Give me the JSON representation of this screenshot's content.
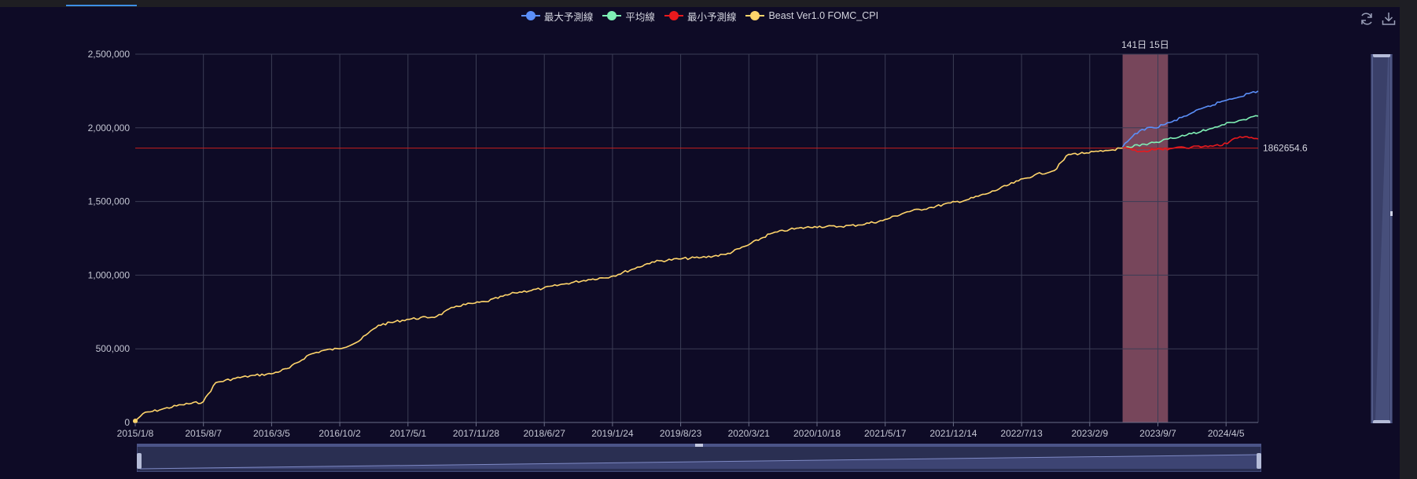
{
  "legend": [
    {
      "label": "最大予測線",
      "color": "#5b8ff9"
    },
    {
      "label": "平均線",
      "color": "#7ff0b5"
    },
    {
      "label": "最小予測線",
      "color": "#e8191d"
    },
    {
      "label": "Beast Ver1.0 FOMC_CPI",
      "color": "#ffd56b"
    }
  ],
  "toolbox": {
    "refresh_icon": "refresh-icon",
    "download_icon": "download-icon"
  },
  "chart_data": {
    "type": "line",
    "x_tick_labels": [
      "2015/1/8",
      "2015/8/7",
      "2016/3/5",
      "2016/10/2",
      "2017/5/1",
      "2017/11/28",
      "2018/6/27",
      "2019/1/24",
      "2019/8/23",
      "2020/3/21",
      "2020/10/18",
      "2021/5/17",
      "2021/12/14",
      "2022/7/13",
      "2023/2/9",
      "2023/9/7",
      "2024/4/5"
    ],
    "y_tick_labels": [
      "0",
      "500,000",
      "1,000,000",
      "1,500,000",
      "2,000,000",
      "2,500,000"
    ],
    "ylim": [
      0,
      2500000
    ],
    "xlim": [
      "2015-01-08",
      "2024-07-26"
    ],
    "grid": true,
    "legend_position": "top-center",
    "series": [
      {
        "name": "Beast Ver1.0 FOMC_CPI",
        "color": "#ffd56b",
        "x": [
          "2015-01-08",
          "2015-02-01",
          "2015-04-01",
          "2015-06-01",
          "2015-08-07",
          "2015-09-15",
          "2015-11-15",
          "2016-01-15",
          "2016-03-05",
          "2016-05-01",
          "2016-07-01",
          "2016-08-15",
          "2016-10-02",
          "2016-12-01",
          "2017-02-01",
          "2017-05-01",
          "2017-08-01",
          "2017-10-01",
          "2017-11-28",
          "2018-01-01",
          "2018-04-01",
          "2018-06-27",
          "2018-09-01",
          "2018-11-15",
          "2019-01-24",
          "2019-04-01",
          "2019-06-01",
          "2019-08-23",
          "2019-11-01",
          "2020-01-15",
          "2020-03-21",
          "2020-06-01",
          "2020-08-01",
          "2020-10-18",
          "2021-01-01",
          "2021-03-01",
          "2021-05-17",
          "2021-08-01",
          "2021-10-15",
          "2021-12-14",
          "2022-02-01",
          "2022-04-15",
          "2022-07-13",
          "2022-09-01",
          "2022-11-01",
          "2022-12-15",
          "2023-02-09",
          "2023-04-01",
          "2023-06-01"
        ],
        "y": [
          10000,
          60000,
          90000,
          120000,
          140000,
          270000,
          300000,
          320000,
          330000,
          370000,
          460000,
          490000,
          500000,
          550000,
          660000,
          700000,
          720000,
          790000,
          810000,
          820000,
          880000,
          910000,
          940000,
          970000,
          990000,
          1040000,
          1090000,
          1110000,
          1120000,
          1140000,
          1200000,
          1280000,
          1310000,
          1330000,
          1330000,
          1340000,
          1370000,
          1430000,
          1460000,
          1490000,
          1510000,
          1560000,
          1640000,
          1680000,
          1710000,
          1820000,
          1830000,
          1840000,
          1862654
        ]
      },
      {
        "name": "最大予測線",
        "color": "#5b8ff9",
        "x": [
          "2023-06-01",
          "2023-07-01",
          "2023-08-01",
          "2023-09-07",
          "2023-11-01",
          "2024-01-01",
          "2024-04-05",
          "2024-07-26"
        ],
        "y": [
          1870000,
          1940000,
          1990000,
          2000000,
          2040000,
          2100000,
          2180000,
          2250000
        ]
      },
      {
        "name": "平均線",
        "color": "#7ff0b5",
        "x": [
          "2023-06-01",
          "2023-09-07",
          "2024-01-01",
          "2024-04-05",
          "2024-07-26"
        ],
        "y": [
          1862654,
          1900000,
          1960000,
          2020000,
          2080000
        ]
      },
      {
        "name": "最小予測線",
        "color": "#e8191d",
        "x": [
          "2023-06-01",
          "2023-08-01",
          "2023-09-07",
          "2023-11-01",
          "2024-01-01",
          "2024-04-05",
          "2024-05-15",
          "2024-06-15",
          "2024-07-26"
        ],
        "y": [
          1862654,
          1840000,
          1850000,
          1860000,
          1870000,
          1880000,
          1930000,
          1940000,
          1925000
        ]
      }
    ],
    "reference_line": {
      "value": 1862654.6,
      "label": "1862654.6",
      "color": "#c81e1e"
    },
    "highlight_band": {
      "label": "141日 15日",
      "start": "2023-06-01",
      "end": "2023-10-20"
    }
  }
}
